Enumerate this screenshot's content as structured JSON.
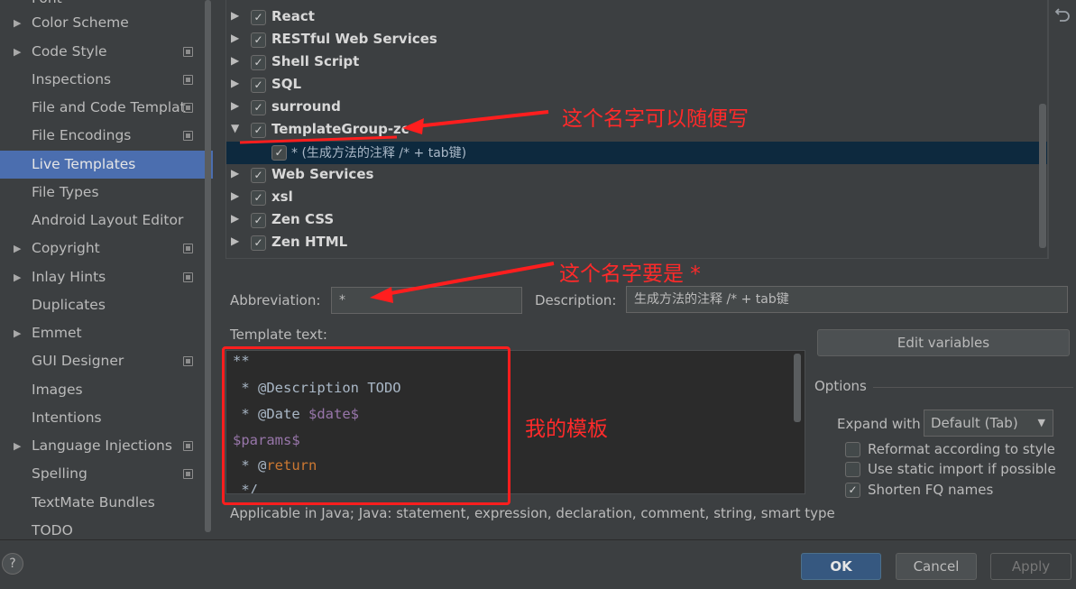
{
  "sidebar": {
    "items": [
      {
        "label": "Font",
        "expandable": false,
        "has_copy_icon": false
      },
      {
        "label": "Color Scheme",
        "expandable": true,
        "has_copy_icon": false
      },
      {
        "label": "Code Style",
        "expandable": true,
        "has_copy_icon": true
      },
      {
        "label": "Inspections",
        "expandable": false,
        "has_copy_icon": true
      },
      {
        "label": "File and Code Templat",
        "expandable": false,
        "has_copy_icon": true
      },
      {
        "label": "File Encodings",
        "expandable": false,
        "has_copy_icon": true
      },
      {
        "label": "Live Templates",
        "expandable": false,
        "has_copy_icon": false,
        "selected": true
      },
      {
        "label": "File Types",
        "expandable": false,
        "has_copy_icon": false
      },
      {
        "label": "Android Layout Editor",
        "expandable": false,
        "has_copy_icon": false
      },
      {
        "label": "Copyright",
        "expandable": true,
        "has_copy_icon": true
      },
      {
        "label": "Inlay Hints",
        "expandable": true,
        "has_copy_icon": true
      },
      {
        "label": "Duplicates",
        "expandable": false,
        "has_copy_icon": false
      },
      {
        "label": "Emmet",
        "expandable": true,
        "has_copy_icon": false
      },
      {
        "label": "GUI Designer",
        "expandable": false,
        "has_copy_icon": true
      },
      {
        "label": "Images",
        "expandable": false,
        "has_copy_icon": false
      },
      {
        "label": "Intentions",
        "expandable": false,
        "has_copy_icon": false
      },
      {
        "label": "Language Injections",
        "expandable": true,
        "has_copy_icon": true
      },
      {
        "label": "Spelling",
        "expandable": false,
        "has_copy_icon": true
      },
      {
        "label": "TextMate Bundles",
        "expandable": false,
        "has_copy_icon": false
      },
      {
        "label": "TODO",
        "expandable": false,
        "has_copy_icon": false
      }
    ]
  },
  "tree": {
    "groups": [
      {
        "label": "React",
        "checked": true,
        "expanded": false
      },
      {
        "label": "RESTful Web Services",
        "checked": true,
        "expanded": false
      },
      {
        "label": "Shell Script",
        "checked": true,
        "expanded": false
      },
      {
        "label": "SQL",
        "checked": true,
        "expanded": false
      },
      {
        "label": "surround",
        "checked": true,
        "expanded": false
      },
      {
        "label": "TemplateGroup-zc",
        "checked": true,
        "expanded": true
      },
      {
        "label": "* (生成方法的注释 /* + tab键)",
        "checked": true,
        "child": true
      },
      {
        "label": "Web Services",
        "checked": true,
        "expanded": false
      },
      {
        "label": "xsl",
        "checked": true,
        "expanded": false
      },
      {
        "label": "Zen CSS",
        "checked": true,
        "expanded": false
      },
      {
        "label": "Zen HTML",
        "checked": true,
        "expanded": false
      }
    ]
  },
  "form": {
    "abbreviation_label": "Abbreviation:",
    "abbreviation_value": "*",
    "description_label": "Description:",
    "description_value": "生成方法的注释 /* + tab键",
    "template_text_label": "Template text:",
    "applicable_text": "Applicable in Java; Java: statement, expression, declaration, comment, string, smart type"
  },
  "template_code": {
    "line1": "**",
    "line2": " * @Description TODO",
    "line3_prefix": " * @Date ",
    "line3_var": "$date$",
    "line4": "$params$",
    "line5_prefix": " * @",
    "line5_kw": "return",
    "line6": " */"
  },
  "options": {
    "edit_variables_label": "Edit variables",
    "section_title": "Options",
    "expand_with_label": "Expand with",
    "expand_with_value": "Default (Tab)",
    "checkboxes": [
      {
        "label": "Reformat according to style",
        "checked": false
      },
      {
        "label": "Use static import if possible",
        "checked": false
      },
      {
        "label": "Shorten FQ names",
        "checked": true
      }
    ]
  },
  "buttons": {
    "ok": "OK",
    "cancel": "Cancel",
    "apply": "Apply",
    "help": "?"
  },
  "annotations": {
    "group_name_note": "这个名字可以随便写",
    "abbreviation_note": "这个名字要是 *",
    "template_note": "我的模板"
  },
  "colors": {
    "selection": "#4b6eaf",
    "tree_child_selection": "#0d293e",
    "annotation_red": "#ff1e1e",
    "ok_button": "#365880"
  }
}
